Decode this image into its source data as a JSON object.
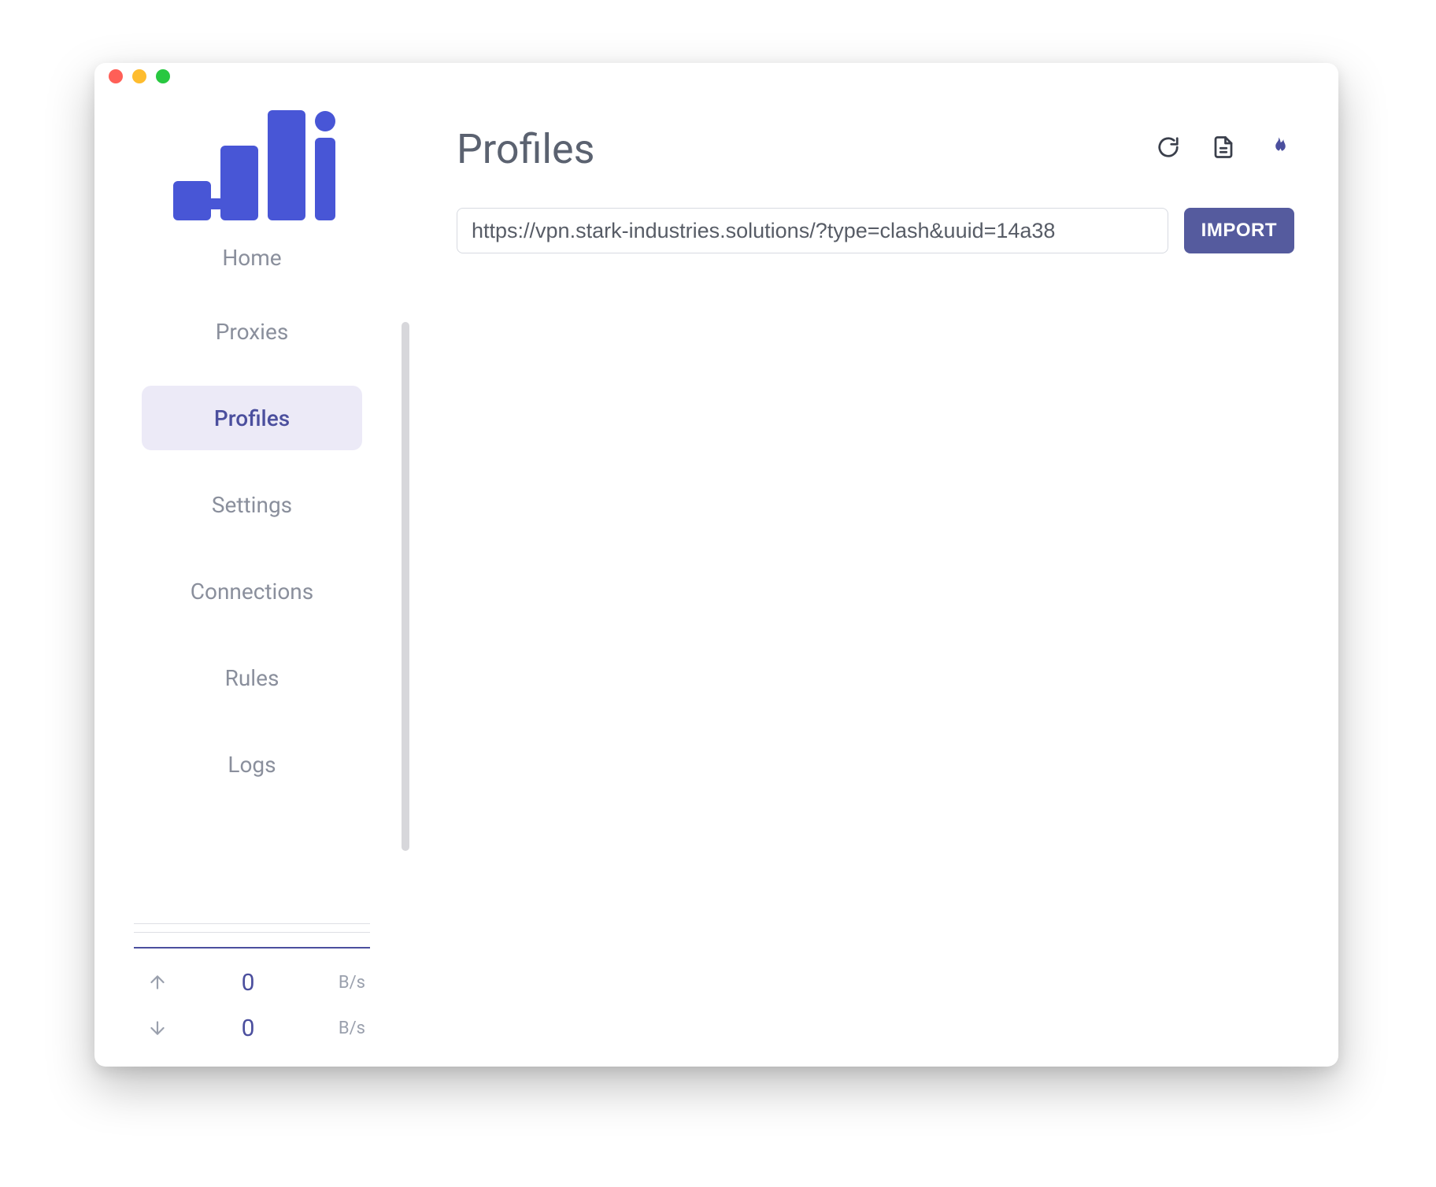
{
  "page": {
    "title": "Profiles"
  },
  "sidebar": {
    "items": [
      {
        "label": "Home"
      },
      {
        "label": "Proxies"
      },
      {
        "label": "Profiles"
      },
      {
        "label": "Settings"
      },
      {
        "label": "Connections"
      },
      {
        "label": "Rules"
      },
      {
        "label": "Logs"
      }
    ],
    "active_index": 2
  },
  "url_bar": {
    "value": "https://vpn.stark-industries.solutions/?type=clash&uuid=14a38",
    "import_label": "IMPORT"
  },
  "stats": {
    "upload": {
      "value": "0",
      "unit": "B/s"
    },
    "download": {
      "value": "0",
      "unit": "B/s"
    }
  },
  "colors": {
    "accent": "#4b4f9e",
    "sidebar_active_bg": "#eceaf7",
    "text_muted": "#8a8f9c"
  }
}
